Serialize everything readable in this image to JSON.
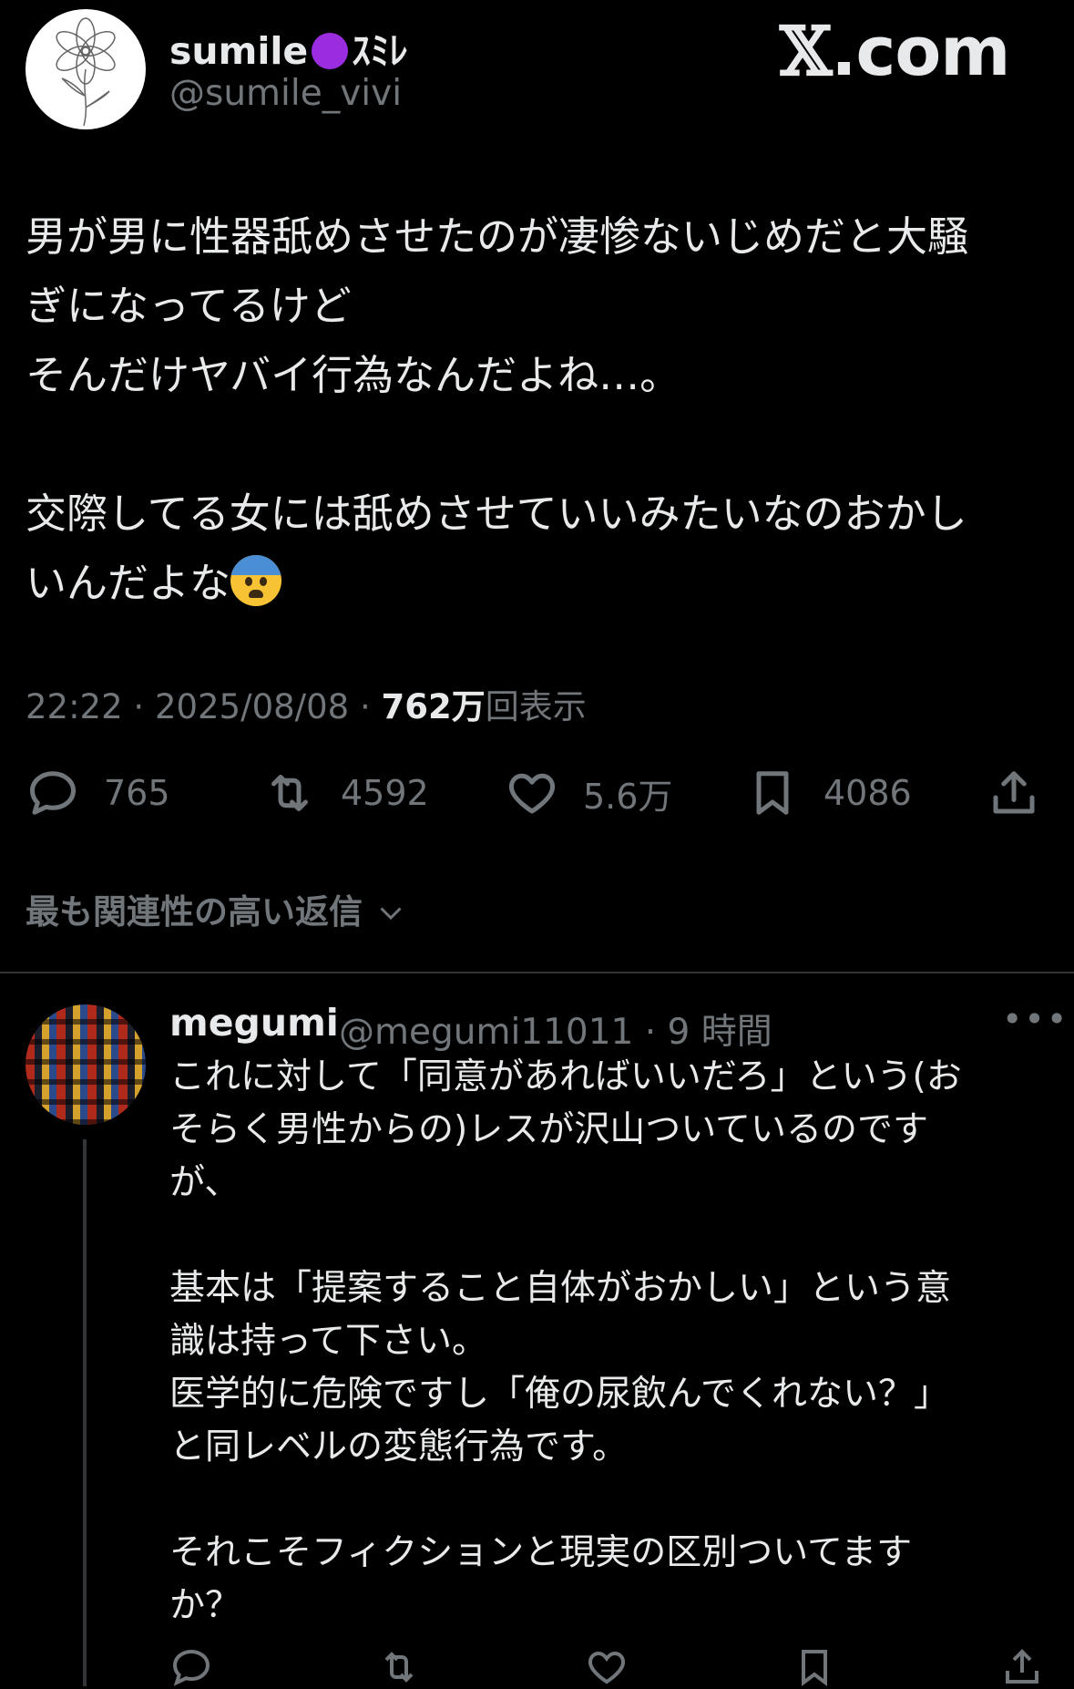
{
  "header": {
    "display_name_pre": "sumile",
    "display_name_post": "ｽﾐﾚ",
    "handle": "@sumile_vivi",
    "watermark_x": "𝕏",
    "watermark_rest": ".com"
  },
  "tweet": {
    "text_main": "男が男に性器舐めさせたのが凄惨ないじめだと大騒\nぎになってるけど\nそんだけヤバイ行為なんだよね…。\n\n交際してる女には舐めさせていいみたいなのおかし\nいんだよな",
    "emoji": "fearful-face",
    "time": "22:22",
    "date": "2025/08/08",
    "views_num": "762万",
    "views_label": "回表示"
  },
  "actions": {
    "replies": "765",
    "reposts": "4592",
    "likes": "5.6万",
    "bookmarks": "4086"
  },
  "sort_label": "最も関連性の高い返信",
  "reply": {
    "display_name": "megumi",
    "handle_time": "@megumi11011 · 9 時間",
    "more": "•••",
    "text": "これに対して「同意があればいいだろ」という(お\nそらく男性からの)レスが沢山ついているのです\nが、\n\n基本は「提案すること自体がおかしい」という意\n識は持って下さい。\n医学的に危険ですし「俺の尿飲んでくれない？」\nと同レベルの変態行為です。\n\nそれこそフィクションと現実の区別ついてます\nか？"
  },
  "colors": {
    "background": "#000000",
    "text_primary": "#e7e9ea",
    "text_secondary": "#71767b",
    "divider": "#2f3336",
    "purple_dot": "#9b2de0"
  }
}
